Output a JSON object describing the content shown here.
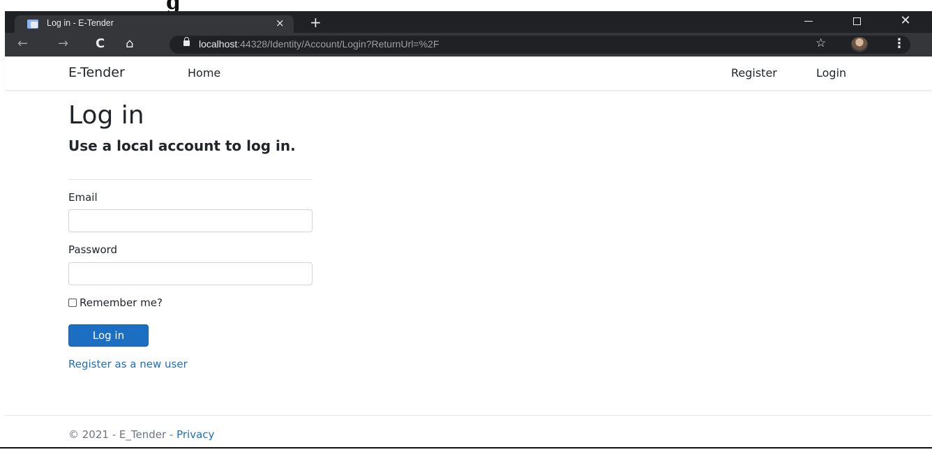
{
  "browser": {
    "tab_title": "Log in - E-Tender",
    "tab_close": "×",
    "new_tab": "+",
    "url_host": "localhost",
    "url_rest": ":44328/Identity/Account/Login?ReturnUrl=%2F",
    "ghost_text": "g"
  },
  "navbar": {
    "brand": "E-Tender",
    "home": "Home",
    "register": "Register",
    "login": "Login"
  },
  "page": {
    "title": "Log in",
    "subtitle": "Use a local account to log in.",
    "email_label": "Email",
    "email_value": "",
    "password_label": "Password",
    "password_value": "",
    "remember_label": "Remember me?",
    "remember_checked": false,
    "submit_label": "Log in",
    "register_link": "Register as a new user"
  },
  "footer": {
    "text": "© 2021 - E_Tender - ",
    "privacy": "Privacy"
  },
  "colors": {
    "accent": "#1b6ec2",
    "chrome_dark": "#202124",
    "chrome_toolbar": "#35363a"
  }
}
